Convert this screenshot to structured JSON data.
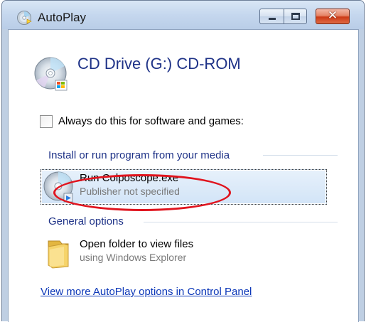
{
  "window": {
    "title": "AutoPlay",
    "icons": {
      "title": "autoplay-cd-icon",
      "minimize": "minimize-icon",
      "maximize": "maximize-icon",
      "close": "close-icon"
    },
    "close_glyph": "✕"
  },
  "drive": {
    "title": "CD Drive (G:) CD-ROM",
    "icon": "cd-drive-icon"
  },
  "always_checkbox": {
    "label": "Always do this for software and games:",
    "checked": false
  },
  "sections": [
    {
      "header": "Install or run program from your media",
      "options": [
        {
          "title": "Run Colposcope.exe",
          "subtitle": "Publisher not specified",
          "icon": "program-disc-icon",
          "selected": true
        }
      ]
    },
    {
      "header": "General options",
      "options": [
        {
          "title": "Open folder to view files",
          "subtitle": "using Windows Explorer",
          "icon": "folder-icon",
          "selected": false
        }
      ]
    }
  ],
  "footer_link": "View more AutoPlay options in Control Panel",
  "colors": {
    "accent_text": "#1e3287",
    "link": "#0d38b8",
    "annotation": "#e0141e",
    "selection": "#d2e4f7"
  }
}
